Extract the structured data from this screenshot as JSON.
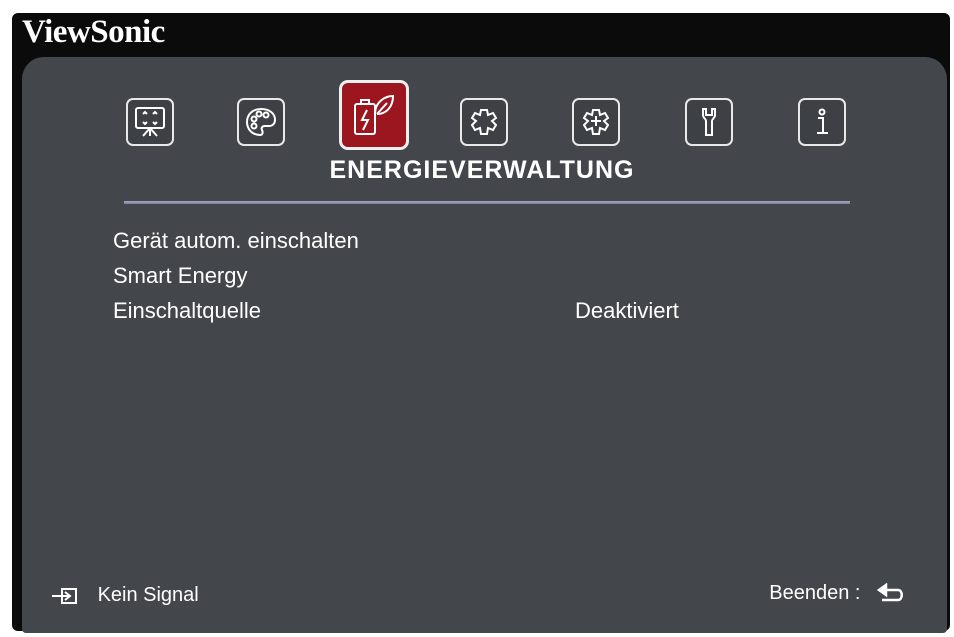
{
  "brand": "ViewSonic",
  "tabs": [
    {
      "name": "Anzeige",
      "icon": "display-icon",
      "active": false
    },
    {
      "name": "Bild",
      "icon": "palette-icon",
      "active": false
    },
    {
      "name": "Energieverwaltung",
      "icon": "battery-leaf-icon",
      "active": true
    },
    {
      "name": "Basis",
      "icon": "gear-icon",
      "active": false
    },
    {
      "name": "Erweitert",
      "icon": "gear-plus-icon",
      "active": false
    },
    {
      "name": "System",
      "icon": "wrench-icon",
      "active": false
    },
    {
      "name": "Information",
      "icon": "info-icon",
      "active": false
    }
  ],
  "section_title": "ENERGIEVERWALTUNG",
  "menu": {
    "items": [
      {
        "label": "Gerät autom. einschalten",
        "value": ""
      },
      {
        "label": "Smart Energy",
        "value": ""
      },
      {
        "label": "Einschaltquelle",
        "value": "Deaktiviert"
      }
    ]
  },
  "footer": {
    "source_icon": "input-source-icon",
    "status": "Kein Signal",
    "exit_label": "Beenden :",
    "exit_icon": "return-icon"
  },
  "colors": {
    "panel": "#43474c",
    "frame": "#0b0b0b",
    "active_tab": "#9c1620",
    "divider": "#9494b4"
  }
}
